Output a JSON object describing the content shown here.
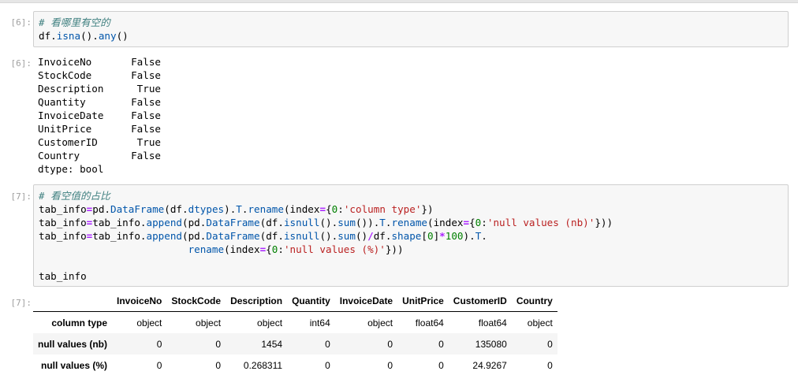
{
  "cells": [
    {
      "input_prompt": "[6]:",
      "code": [
        [
          [
            "tok-com",
            "# 看哪里有空的"
          ]
        ],
        [
          [
            "tok-var",
            "df."
          ],
          [
            "tok-fn",
            "isna"
          ],
          [
            "tok-var",
            "()."
          ],
          [
            "tok-fn",
            "any"
          ],
          [
            "tok-var",
            "()"
          ]
        ]
      ],
      "output_prompt": "[6]:",
      "output": {
        "rows": [
          {
            "key": "InvoiceNo",
            "value": "False"
          },
          {
            "key": "StockCode",
            "value": "False"
          },
          {
            "key": "Description",
            "value": "True"
          },
          {
            "key": "Quantity",
            "value": "False"
          },
          {
            "key": "InvoiceDate",
            "value": "False"
          },
          {
            "key": "UnitPrice",
            "value": "False"
          },
          {
            "key": "CustomerID",
            "value": "True"
          },
          {
            "key": "Country",
            "value": "False"
          }
        ],
        "dtype_line": "dtype: bool"
      }
    },
    {
      "input_prompt": "[7]:",
      "code": [
        [
          [
            "tok-com",
            "# 看空值的占比"
          ]
        ],
        [
          [
            "tok-var",
            "tab_info"
          ],
          [
            "tok-op",
            "="
          ],
          [
            "tok-var",
            "pd."
          ],
          [
            "tok-fn",
            "DataFrame"
          ],
          [
            "tok-var",
            "(df."
          ],
          [
            "tok-fn",
            "dtypes"
          ],
          [
            "tok-var",
            ")."
          ],
          [
            "tok-fn",
            "T"
          ],
          [
            "tok-var",
            "."
          ],
          [
            "tok-fn",
            "rename"
          ],
          [
            "tok-var",
            "(index"
          ],
          [
            "tok-op",
            "="
          ],
          [
            "tok-var",
            "{"
          ],
          [
            "tok-num",
            "0"
          ],
          [
            "tok-var",
            ":"
          ],
          [
            "tok-str",
            "'column type'"
          ],
          [
            "tok-var",
            "})"
          ]
        ],
        [
          [
            "tok-var",
            "tab_info"
          ],
          [
            "tok-op",
            "="
          ],
          [
            "tok-var",
            "tab_info."
          ],
          [
            "tok-fn",
            "append"
          ],
          [
            "tok-var",
            "(pd."
          ],
          [
            "tok-fn",
            "DataFrame"
          ],
          [
            "tok-var",
            "(df."
          ],
          [
            "tok-fn",
            "isnull"
          ],
          [
            "tok-var",
            "()."
          ],
          [
            "tok-fn",
            "sum"
          ],
          [
            "tok-var",
            "())."
          ],
          [
            "tok-fn",
            "T"
          ],
          [
            "tok-var",
            "."
          ],
          [
            "tok-fn",
            "rename"
          ],
          [
            "tok-var",
            "(index"
          ],
          [
            "tok-op",
            "="
          ],
          [
            "tok-var",
            "{"
          ],
          [
            "tok-num",
            "0"
          ],
          [
            "tok-var",
            ":"
          ],
          [
            "tok-str",
            "'null values (nb)'"
          ],
          [
            "tok-var",
            "}))"
          ]
        ],
        [
          [
            "tok-var",
            "tab_info"
          ],
          [
            "tok-op",
            "="
          ],
          [
            "tok-var",
            "tab_info."
          ],
          [
            "tok-fn",
            "append"
          ],
          [
            "tok-var",
            "(pd."
          ],
          [
            "tok-fn",
            "DataFrame"
          ],
          [
            "tok-var",
            "(df."
          ],
          [
            "tok-fn",
            "isnull"
          ],
          [
            "tok-var",
            "()."
          ],
          [
            "tok-fn",
            "sum"
          ],
          [
            "tok-var",
            "()"
          ],
          [
            "tok-op",
            "/"
          ],
          [
            "tok-var",
            "df."
          ],
          [
            "tok-fn",
            "shape"
          ],
          [
            "tok-var",
            "["
          ],
          [
            "tok-num",
            "0"
          ],
          [
            "tok-var",
            "]"
          ],
          [
            "tok-op",
            "*"
          ],
          [
            "tok-num",
            "100"
          ],
          [
            "tok-var",
            ")."
          ],
          [
            "tok-fn",
            "T"
          ],
          [
            "tok-var",
            "."
          ]
        ],
        [
          [
            "tok-var",
            "                         "
          ],
          [
            "tok-fn",
            "rename"
          ],
          [
            "tok-var",
            "(index"
          ],
          [
            "tok-op",
            "="
          ],
          [
            "tok-var",
            "{"
          ],
          [
            "tok-num",
            "0"
          ],
          [
            "tok-var",
            ":"
          ],
          [
            "tok-str",
            "'null values (%)'"
          ],
          [
            "tok-var",
            "}))"
          ]
        ],
        [
          [
            "tok-var",
            ""
          ]
        ],
        [
          [
            "tok-var",
            "tab_info"
          ]
        ]
      ],
      "output_prompt": "[7]:",
      "output_table": {
        "columns": [
          "",
          "InvoiceNo",
          "StockCode",
          "Description",
          "Quantity",
          "InvoiceDate",
          "UnitPrice",
          "CustomerID",
          "Country"
        ],
        "rows": [
          [
            "column type",
            "object",
            "object",
            "object",
            "int64",
            "object",
            "float64",
            "float64",
            "object"
          ],
          [
            "null values (nb)",
            "0",
            "0",
            "1454",
            "0",
            "0",
            "0",
            "135080",
            "0"
          ],
          [
            "null values (%)",
            "0",
            "0",
            "0.268311",
            "0",
            "0",
            "0",
            "24.9267",
            "0"
          ]
        ]
      }
    }
  ]
}
